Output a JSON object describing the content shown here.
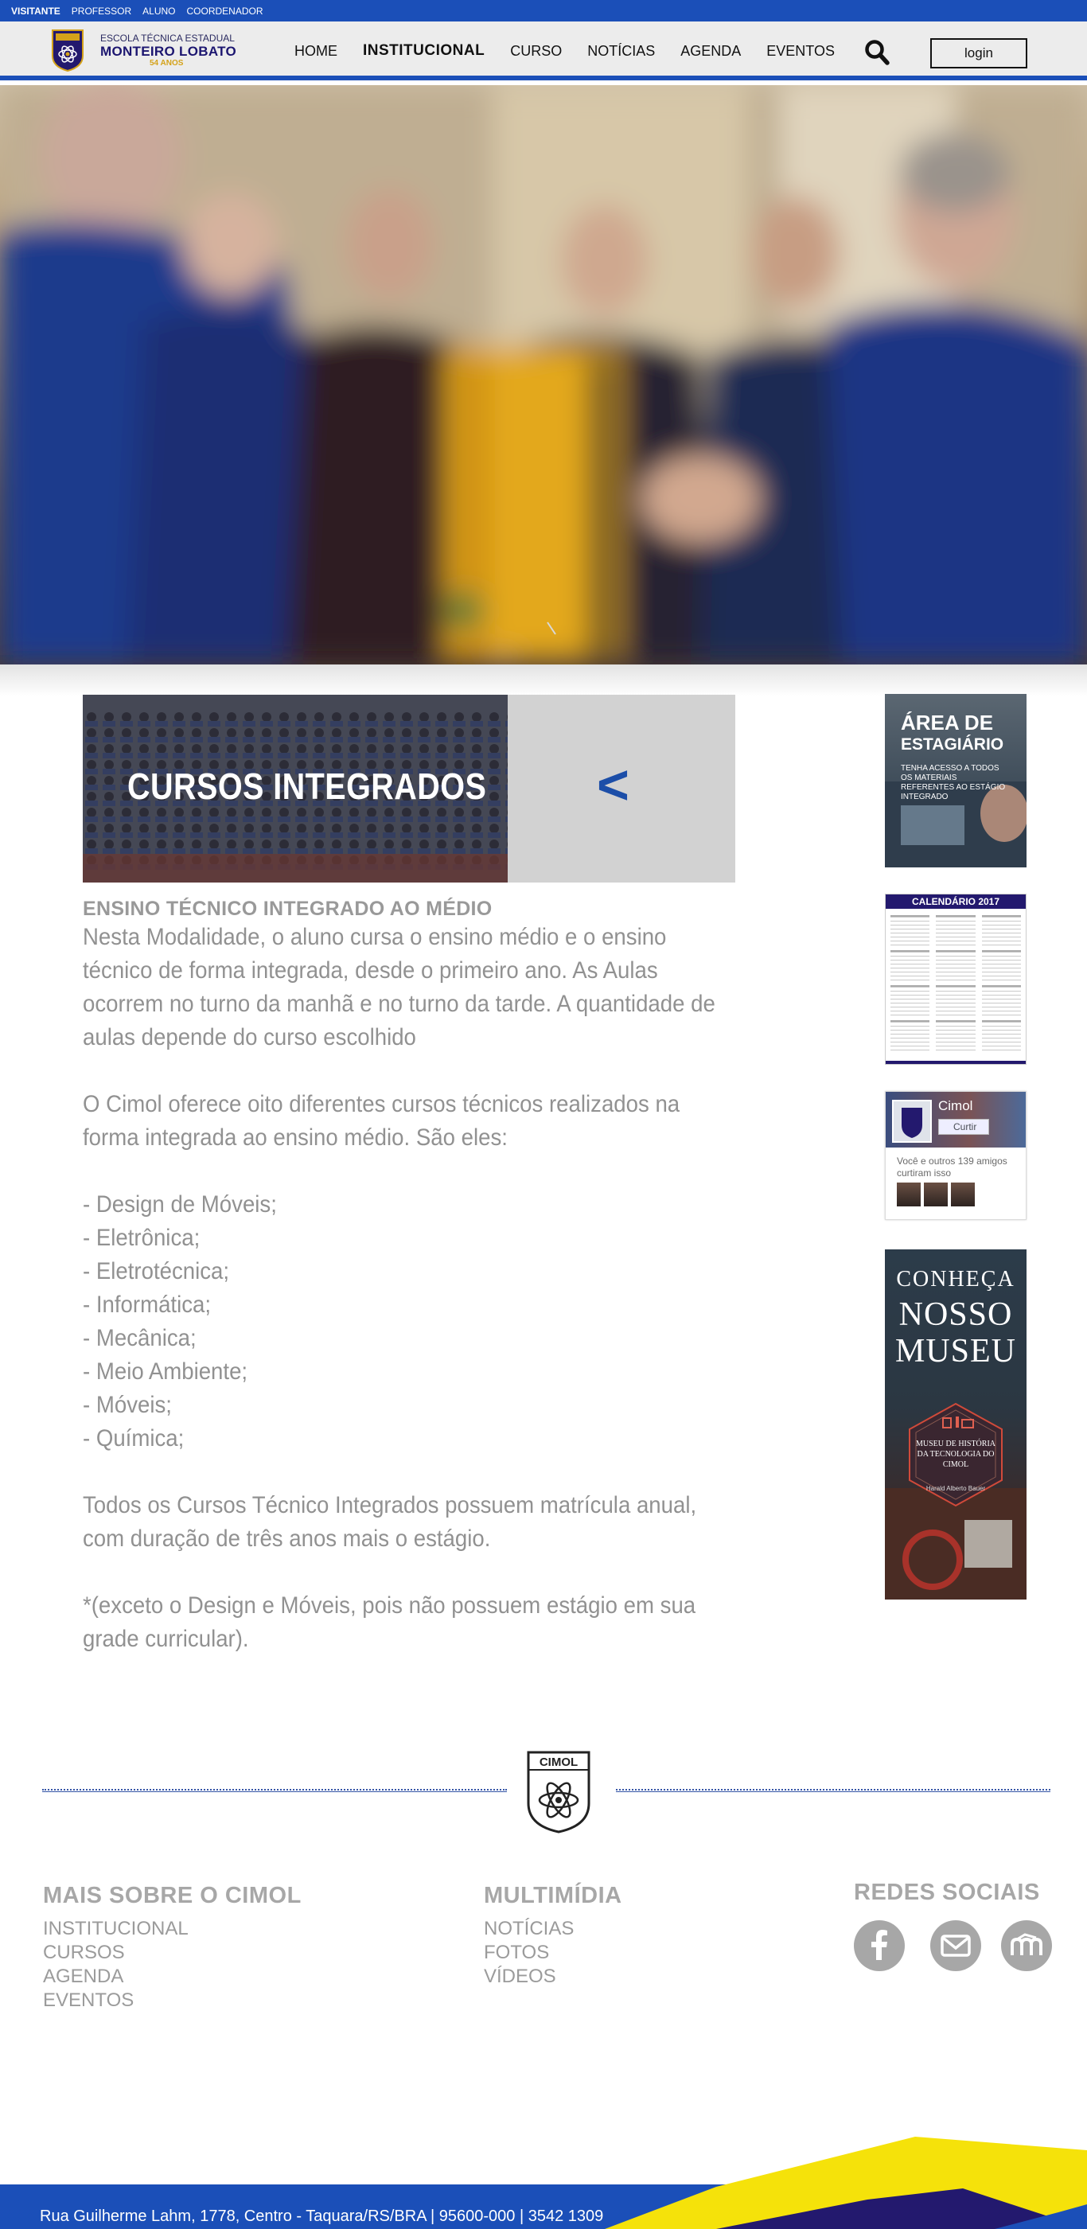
{
  "top_links": [
    "VISITANTE",
    "PROFESSOR",
    "ALUNO",
    "COORDENADOR"
  ],
  "brand": {
    "line1": "ESCOLA TÉCNICA ESTADUAL",
    "line2": "MONTEIRO LOBATO",
    "line3": "54 ANOS",
    "logo_text": "CIMOL"
  },
  "nav": [
    "HOME",
    "INSTITUCIONAL",
    "CURSO",
    "NOTÍCIAS",
    "AGENDA",
    "EVENTOS"
  ],
  "login_label": "login",
  "banner": {
    "title": "CURSOS INTEGRADOS",
    "arrow": "<"
  },
  "article": {
    "subtitle": "ENSINO TÉCNICO INTEGRADO AO MÉDIO",
    "intro": "Nesta Modalidade, o aluno cursa o ensino médio e o ensino técnico de forma integrada, desde o primeiro ano. As Aulas ocorrem no turno da manhã e no turno da tarde. A quantidade de aulas depende do curso escolhido",
    "offer": "O Cimol oferece oito diferentes cursos técnicos realizados na forma integrada ao ensino médio. São eles:",
    "courses": [
      "- Design de Móveis;",
      "- Eletrônica;",
      "- Eletrotécnica;",
      "- Informática;",
      "- Mecânica;",
      "- Meio Ambiente;",
      "- Móveis;",
      "- Química;"
    ],
    "duration": "Todos os Cursos Técnico Integrados possuem matrícula anual, com duração de três anos mais o estágio.",
    "note": "*(exceto o Design e Móveis, pois não possuem estágio em sua grade curricular)."
  },
  "sidebar": {
    "estagiario": {
      "title1": "ÁREA DE",
      "title2": "ESTAGIÁRIO",
      "text": "TENHA ACESSO A TODOS OS MATERIAIS REFERENTES AO ESTÁGIO INTEGRADO"
    },
    "calendar": {
      "title": "CALENDÁRIO 2017"
    },
    "facebook": {
      "name": "Cimol",
      "like": "Curtir",
      "friends": "Você e outros 139 amigos curtiram isso"
    },
    "museu": {
      "line1": "CONHEÇA",
      "line2": "NOSSO",
      "line3": "MUSEU",
      "badge": "MUSEU DE HISTÓRIA DA TECNOLOGIA DO CIMOL",
      "badge_small": "Harald Alberto Bauer"
    }
  },
  "footer": {
    "col1_title": "MAIS SOBRE O CIMOL",
    "col1_links": [
      "INSTITUCIONAL",
      "CURSOS",
      "AGENDA",
      "EVENTOS"
    ],
    "col2_title": "MULTIMÍDIA",
    "col2_links": [
      "NOTÍCIAS",
      "FOTOS",
      "VÍDEOS"
    ],
    "col3_title": "REDES SOCIAIS",
    "social_icons": [
      "facebook-icon",
      "email-icon",
      "moodle-icon"
    ],
    "logo_text": "CIMOL",
    "address": "Rua Guilherme Lahm, 1778, Centro - Taquara/RS/BRA | 95600-000 | 3542 1309"
  },
  "colors": {
    "brand_blue": "#1b4fb8",
    "navy": "#23196e",
    "yellow": "#f5e20a",
    "gray_text": "#919191"
  }
}
